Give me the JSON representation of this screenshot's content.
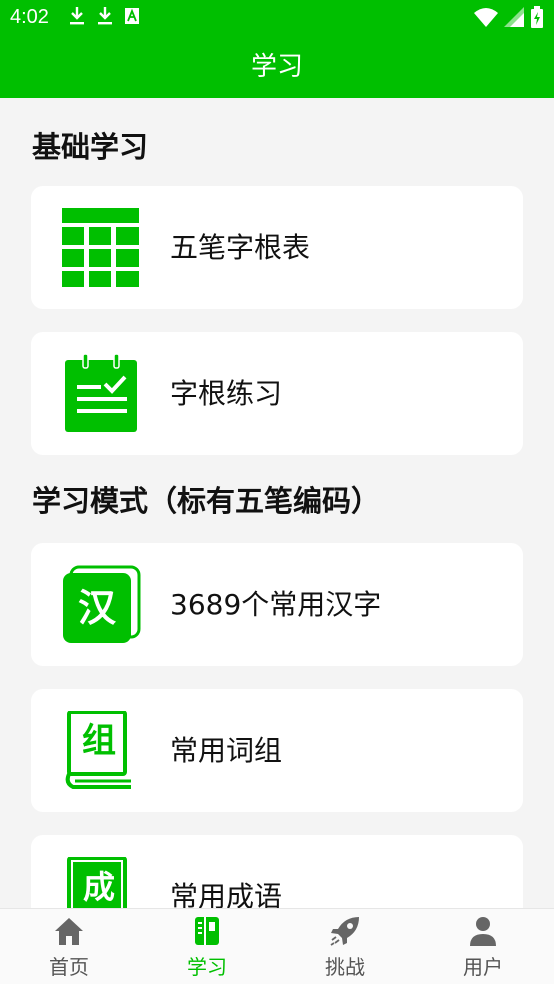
{
  "status_bar": {
    "time": "4:02"
  },
  "app_bar": {
    "title": "学习"
  },
  "sections": [
    {
      "title": "基础学习"
    },
    {
      "title": "学习模式（标有五笔编码）"
    }
  ],
  "cards": [
    {
      "label": "五笔字根表",
      "icon": "table-grid-icon"
    },
    {
      "label": "字根练习",
      "icon": "checklist-icon"
    },
    {
      "label": "3689个常用汉字",
      "icon": "han-char-icon",
      "icon_text": "汉"
    },
    {
      "label": "常用词组",
      "icon": "zu-book-icon",
      "icon_text": "组"
    },
    {
      "label": "常用成语",
      "icon": "cheng-book-icon",
      "icon_text": "成"
    }
  ],
  "bottom_nav": [
    {
      "label": "首页",
      "icon": "home-icon",
      "active": false
    },
    {
      "label": "学习",
      "icon": "book-icon",
      "active": true
    },
    {
      "label": "挑战",
      "icon": "rocket-icon",
      "active": false
    },
    {
      "label": "用户",
      "icon": "user-icon",
      "active": false
    }
  ],
  "colors": {
    "accent": "#00bf00",
    "background": "#f4f4f4",
    "nav_inactive": "#555555"
  }
}
